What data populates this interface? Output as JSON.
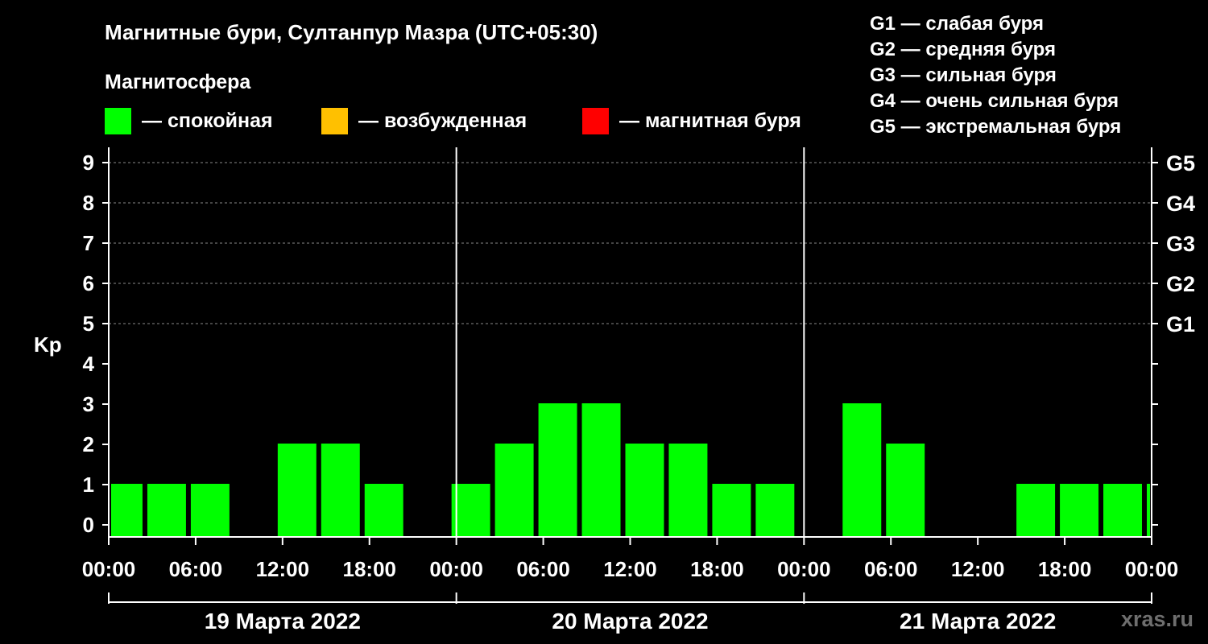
{
  "title": "Магнитные бури, Султанпур Мазра (UTC+05:30)",
  "legend": {
    "heading": "Магнитосфера",
    "items": [
      {
        "label": "— спокойная",
        "color": "#00ff00"
      },
      {
        "label": "— возбужденная",
        "color": "#ffc000"
      },
      {
        "label": "— магнитная буря",
        "color": "#ff0000"
      }
    ]
  },
  "storm_scale": [
    "G1 — слабая буря",
    "G2 — средняя буря",
    "G3 — сильная буря",
    "G4 — очень сильная буря",
    "G5 — экстремальная буря"
  ],
  "watermark": "xras.ru",
  "chart_data": {
    "type": "bar",
    "ylabel": "Kp",
    "ylim": [
      0,
      9
    ],
    "y_ticks": [
      "0",
      "1",
      "2",
      "3",
      "4",
      "5",
      "6",
      "7",
      "8",
      "9"
    ],
    "right_ticks": [
      {
        "value": 5,
        "label": "G1"
      },
      {
        "value": 6,
        "label": "G2"
      },
      {
        "value": 7,
        "label": "G3"
      },
      {
        "value": 8,
        "label": "G4"
      },
      {
        "value": 9,
        "label": "G5"
      }
    ],
    "x_ticks": [
      "00:00",
      "06:00",
      "12:00",
      "18:00",
      "00:00",
      "06:00",
      "12:00",
      "18:00",
      "00:00",
      "06:00",
      "12:00",
      "18:00",
      "00:00"
    ],
    "days": [
      "19 Марта 2022",
      "20 Марта 2022",
      "21 Марта 2022"
    ],
    "bar_color": "#00ff00",
    "bars": [
      {
        "start": "19 Марта 2022 00:00",
        "end": "19 Марта 2022 02:30",
        "kp": 1
      },
      {
        "start": "19 Марта 2022 02:30",
        "end": "19 Марта 2022 05:30",
        "kp": 1
      },
      {
        "start": "19 Марта 2022 05:30",
        "end": "19 Марта 2022 08:30",
        "kp": 1
      },
      {
        "start": "19 Марта 2022 08:30",
        "end": "19 Марта 2022 11:30",
        "kp": 0
      },
      {
        "start": "19 Марта 2022 11:30",
        "end": "19 Марта 2022 14:30",
        "kp": 2
      },
      {
        "start": "19 Марта 2022 14:30",
        "end": "19 Марта 2022 17:30",
        "kp": 2
      },
      {
        "start": "19 Марта 2022 17:30",
        "end": "19 Марта 2022 20:30",
        "kp": 1
      },
      {
        "start": "19 Марта 2022 20:30",
        "end": "19 Марта 2022 23:30",
        "kp": 0
      },
      {
        "start": "19 Марта 2022 23:30",
        "end": "20 Марта 2022 02:30",
        "kp": 1
      },
      {
        "start": "20 Марта 2022 02:30",
        "end": "20 Марта 2022 05:30",
        "kp": 2
      },
      {
        "start": "20 Марта 2022 05:30",
        "end": "20 Марта 2022 08:30",
        "kp": 3
      },
      {
        "start": "20 Марта 2022 08:30",
        "end": "20 Марта 2022 11:30",
        "kp": 3
      },
      {
        "start": "20 Марта 2022 11:30",
        "end": "20 Марта 2022 14:30",
        "kp": 2
      },
      {
        "start": "20 Марта 2022 14:30",
        "end": "20 Марта 2022 17:30",
        "kp": 2
      },
      {
        "start": "20 Марта 2022 17:30",
        "end": "20 Марта 2022 20:30",
        "kp": 1
      },
      {
        "start": "20 Марта 2022 20:30",
        "end": "20 Марта 2022 23:30",
        "kp": 1
      },
      {
        "start": "20 Марта 2022 23:30",
        "end": "21 Марта 2022 02:30",
        "kp": 0
      },
      {
        "start": "21 Марта 2022 02:30",
        "end": "21 Марта 2022 05:30",
        "kp": 3
      },
      {
        "start": "21 Марта 2022 05:30",
        "end": "21 Марта 2022 08:30",
        "kp": 2
      },
      {
        "start": "21 Марта 2022 08:30",
        "end": "21 Марта 2022 11:30",
        "kp": 0
      },
      {
        "start": "21 Марта 2022 11:30",
        "end": "21 Марта 2022 14:30",
        "kp": 0
      },
      {
        "start": "21 Марта 2022 14:30",
        "end": "21 Марта 2022 17:30",
        "kp": 1
      },
      {
        "start": "21 Марта 2022 17:30",
        "end": "21 Марта 2022 20:30",
        "kp": 1
      },
      {
        "start": "21 Марта 2022 20:30",
        "end": "21 Марта 2022 23:30",
        "kp": 1
      },
      {
        "start": "21 Марта 2022 23:30",
        "end": "22 Марта 2022 00:00",
        "kp": 1
      }
    ]
  }
}
